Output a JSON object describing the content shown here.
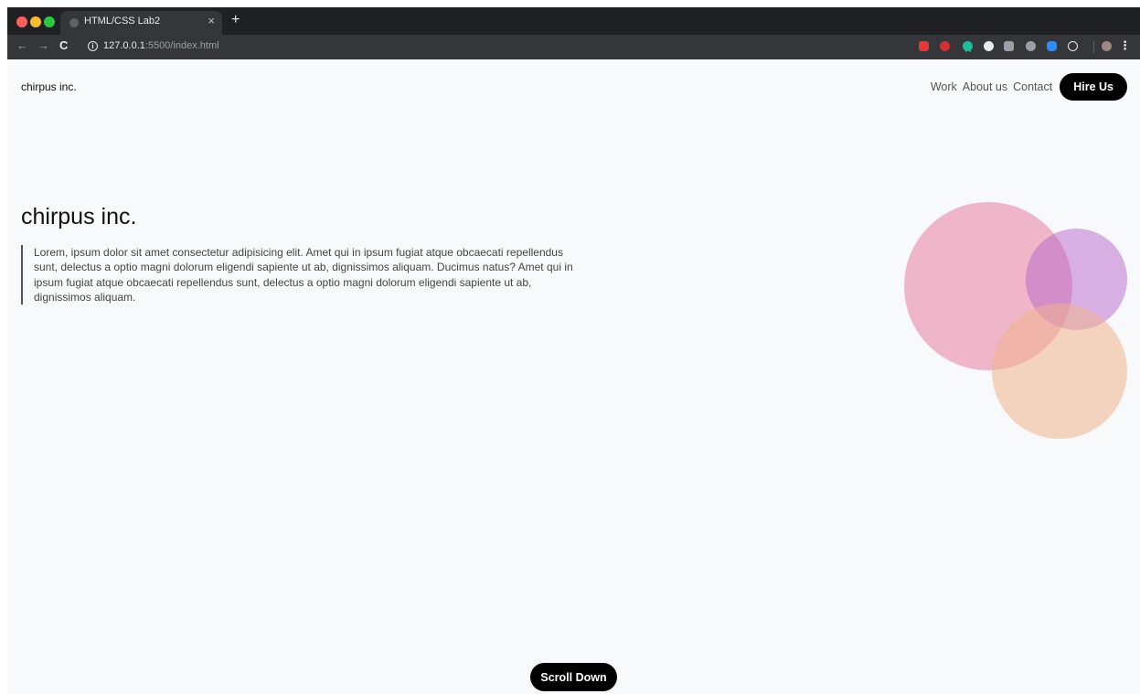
{
  "browser": {
    "tab_title": "HTML/CSS Lab2",
    "close_glyph": "×",
    "new_tab_glyph": "+",
    "back_glyph": "←",
    "forward_glyph": "→",
    "reload_glyph": "C",
    "info_glyph": "i",
    "url_host": "127.0.0.1",
    "url_rest": ":5500/index.html",
    "star_glyph": "☆",
    "menu_glyph": "⋮",
    "extension_icons": [
      "shield-ext-icon",
      "stop-ext-icon",
      "grammarly-ext-icon",
      "circle-ext-icon",
      "k-ext-icon",
      "chat-ext-icon",
      "zoom-ext-icon",
      "react-ext-icon",
      "avatar-icon"
    ]
  },
  "page": {
    "brand": "chirpus inc.",
    "nav": [
      {
        "label": "Work"
      },
      {
        "label": "About us"
      },
      {
        "label": "Contact"
      }
    ],
    "hire_label": "Hire Us",
    "hero_title": "chirpus inc.",
    "hero_text": "Lorem, ipsum dolor sit amet consectetur adipisicing elit. Amet qui in ipsum fugiat atque obcaecati repellendus sunt, delectus a optio magni dolorum eligendi sapiente ut ab, dignissimos aliquam. Ducimus natus? Amet qui in ipsum fugiat atque obcaecati repellendus sunt, delectus a optio magni dolorum eligendi sapiente ut ab, dignissimos aliquam.",
    "scroll_label": "Scroll Down"
  },
  "colors": {
    "page_bg": "#f8f9fb",
    "button_bg": "#000000",
    "circle_pink": "#e87ea1",
    "circle_purple": "#b766c9",
    "circle_peach": "#f1b48c"
  }
}
